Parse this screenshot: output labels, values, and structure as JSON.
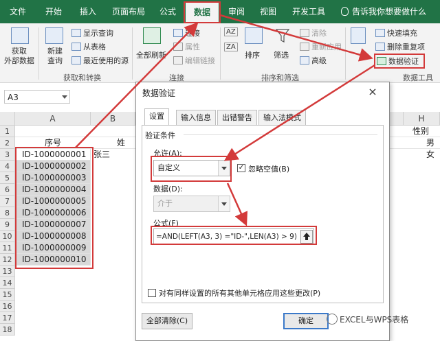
{
  "tabs": [
    {
      "label": "文件",
      "active": false
    },
    {
      "label": "开始",
      "active": false
    },
    {
      "label": "插入",
      "active": false
    },
    {
      "label": "页面布局",
      "active": false
    },
    {
      "label": "公式",
      "active": false
    },
    {
      "label": "数据",
      "active": true
    },
    {
      "label": "审阅",
      "active": false
    },
    {
      "label": "视图",
      "active": false
    },
    {
      "label": "开发工具",
      "active": false
    }
  ],
  "tell_me": "告诉我你想要做什么",
  "ribbon": {
    "get_external_data": "获取\n外部数据",
    "new_query": "新建\n查询",
    "show_queries": "显示查询",
    "from_table": "从表格",
    "recent_sources": "最近使用的源",
    "group_get_transform": "获取和转换",
    "refresh_all": "全部刷新",
    "connections": "连接",
    "properties": "属性",
    "edit_links": "编辑链接",
    "group_connections": "连接",
    "sort_az": "AZ",
    "sort_za": "ZA",
    "sort": "排序",
    "filter": "筛选",
    "clear": "清除",
    "reapply": "重新应用",
    "advanced": "高级",
    "group_sort_filter": "排序和筛选",
    "flash_fill": "快速填充",
    "remove_duplicates": "删除重复项",
    "data_validation": "数据验证",
    "group_data_tools": "数据工具"
  },
  "formula_bar": {
    "name_box": "A3"
  },
  "columns": [
    "A",
    "B",
    "H"
  ],
  "rows": [
    "1",
    "2",
    "3",
    "4",
    "5",
    "6",
    "7",
    "8",
    "9",
    "10",
    "11",
    "12",
    "13",
    "14",
    "15",
    "16",
    "17",
    "18"
  ],
  "cells": {
    "a2": "序号",
    "b2": "姓",
    "b3": "张三",
    "h1": "性别",
    "h2": "男",
    "h3": "女",
    "col_a_ids": [
      "ID-1000000001",
      "ID-1000000002",
      "ID-1000000003",
      "ID-1000000004",
      "ID-1000000005",
      "ID-1000000006",
      "ID-1000000007",
      "ID-1000000008",
      "ID-1000000009",
      "ID-1000000010"
    ]
  },
  "dialog": {
    "title": "数据验证",
    "close": "×",
    "tabs": [
      "设置",
      "输入信息",
      "出错警告",
      "输入法模式"
    ],
    "section": "验证条件",
    "allow_label": "允许(A):",
    "allow_value": "自定义",
    "ignore_blank_label": "忽略空值(B)",
    "ignore_blank_checked": "✓",
    "data_label": "数据(D):",
    "data_value": "介于",
    "formula_label": "公式(F)",
    "formula_value": "=AND(LEFT(A3, 3) =\"ID-\",LEN(A3) > 9)",
    "apply_all_label": "对有同样设置的所有其他单元格应用这些更改(P)",
    "clear_all": "全部清除(C)",
    "ok": "确定"
  },
  "watermark": "EXCEL与WPS表格",
  "colors": {
    "excel_green": "#217346",
    "highlight_red": "#d33a3a"
  }
}
